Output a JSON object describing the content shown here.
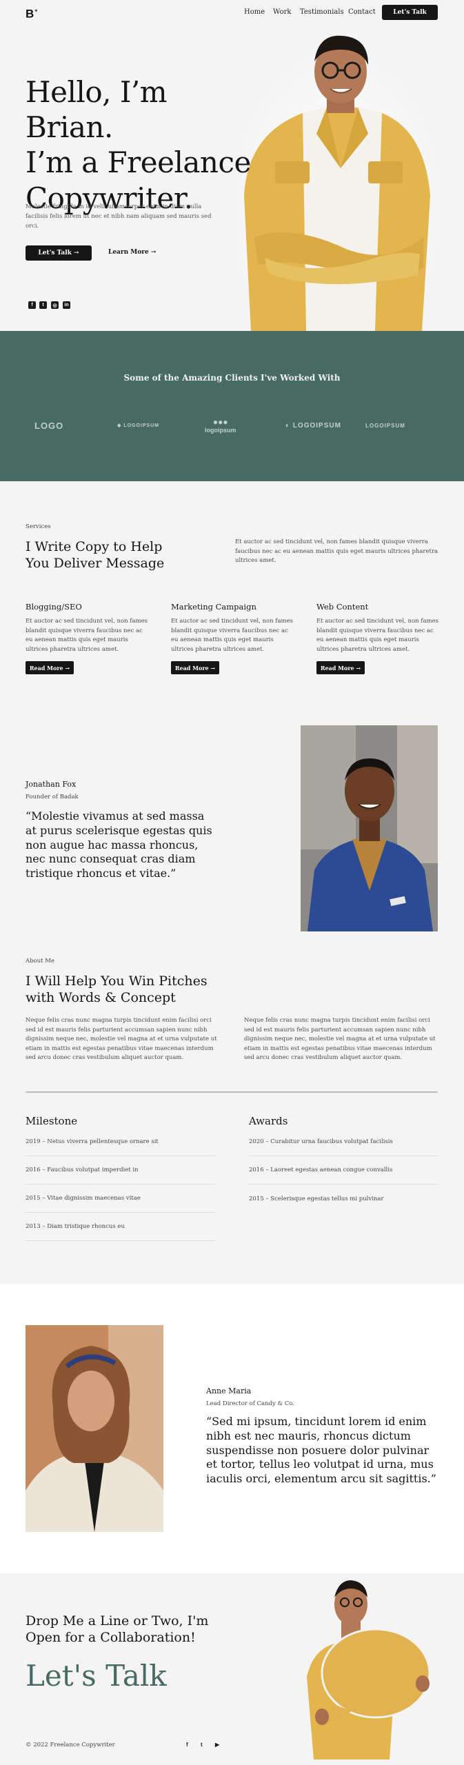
{
  "header": {
    "logo": "B",
    "nav": [
      "Home",
      "Work",
      "Testimonials",
      "Contact"
    ],
    "cta": "Let's Talk"
  },
  "hero": {
    "title_lines": [
      "Hello, I’m Brian.",
      "I’m a Freelance",
      "Copywriter."
    ],
    "paragraph": "Molestie fringilla in id velit ullamcorper enim in diam nulla facilisis felis lorem ut nec et nibh nam aliquam sed mauris sed orci.",
    "primary_button": "Let's Talk →",
    "secondary_button": "Learn More →",
    "socials": [
      "facebook-icon",
      "twitter-icon",
      "instagram-icon",
      "linkedin-icon"
    ]
  },
  "clients": {
    "title": "Some of the Amazing Clients I've Worked With",
    "logos": [
      "LOGO",
      "LOGOIPSUM",
      "logoipsum",
      "LOGOIPSUM",
      "LOGOIPSUM"
    ]
  },
  "services": {
    "label": "Services",
    "title": "I Write Copy to Help You Deliver Message",
    "intro": "Et auctor ac sed tincidunt vel, non fames blandit quisque viverra faucibus nec ac eu aenean mattis quis eget mauris ultrices pharetra ultrices amet.",
    "cards": [
      {
        "title": "Blogging/SEO",
        "text": "Et auctor ac sed tincidunt vel, non fames blandit quisque viverra faucibus nec ac eu aenean mattis quis eget mauris ultrices pharetra ultrices amet.",
        "button": "Read More →"
      },
      {
        "title": "Marketing Campaign",
        "text": "Et auctor ac sed tincidunt vel, non fames blandit quisque viverra faucibus nec ac eu aenean mattis quis eget mauris ultrices pharetra ultrices amet.",
        "button": "Read More →"
      },
      {
        "title": "Web Content",
        "text": "Et auctor ac sed tincidunt vel, non fames blandit quisque viverra faucibus nec ac eu aenean mattis quis eget mauris ultrices pharetra ultrices amet.",
        "button": "Read More →"
      }
    ]
  },
  "testimonial1": {
    "name": "Jonathan Fox",
    "role": "Founder of Badak",
    "quote": "“Molestie vivamus at sed massa at purus scelerisque egestas quis non augue hac massa rhoncus, nec nunc consequat cras diam tristique rhoncus et vitae.”"
  },
  "about": {
    "label": "About Me",
    "title": "I Will Help You Win Pitches with Words & Concept",
    "col1": "Neque felis cras nunc magna turpis tincidunt enim facilisi orci sed id est mauris felis parturient accumsan sapien nunc nibh dignissim neque nec, molestie vel magna at et urna vulputate ut etiam in mattis est egestas penatibus vitae maecenas interdum sed arcu donec cras vestibulum aliquet auctor quam.",
    "col2": "Neque felis cras nunc magna turpis tincidunt enim facilisi orci sed id est mauris felis parturient accumsan sapien nunc nibh dignissim neque nec, molestie vel magna at et urna vulputate ut etiam in mattis est egestas penatibus vitae maecenas interdum sed arcu donec cras vestibulum aliquet auctor quam."
  },
  "milestone": {
    "title": "Milestone",
    "items": [
      "2019 – Netus viverra pellentesque ornare sit",
      "2016 – Faucibus volutpat imperdiet in",
      "2015 – Vitae dignissim maecenas vitae",
      "2013 – Diam tristique rhoncus eu"
    ]
  },
  "awards": {
    "title": "Awards",
    "items": [
      "2020 – Curabitur urna faucibus volutpat facilisis",
      "2016 – Laoreet egestas aenean congue convallis",
      "2015 – Scelerisque egestas tellus mi pulvinar"
    ]
  },
  "testimonial2": {
    "name": "Anne Maria",
    "role": "Lead Director of Candy & Co.",
    "quote": "“Sed mi ipsum, tincidunt lorem id enim nibh est nec mauris, rhoncus dictum suspendisse non posuere dolor pulvinar et tortor, tellus leo volutpat id urna, mus iaculis orci, elementum arcu sit sagittis.”"
  },
  "contact": {
    "heading": "Drop Me a Line or Two, I'm Open for a Collaboration!",
    "big": "Let's Talk",
    "copyright": "© 2022 Freelance Copywriter",
    "socials": [
      "facebook-icon",
      "twitter-icon",
      "youtube-icon"
    ]
  },
  "colors": {
    "accent": "#476b63",
    "dark": "#161616",
    "jacket": "#e2b64c"
  }
}
